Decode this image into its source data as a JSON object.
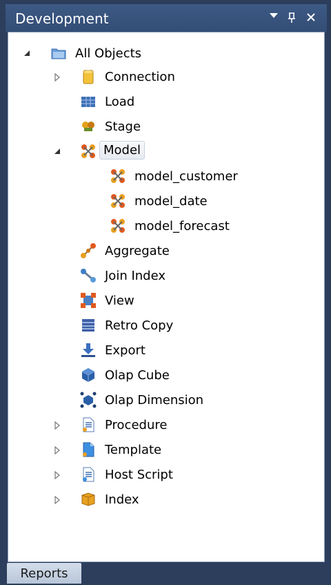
{
  "panel": {
    "title": "Development"
  },
  "tree": {
    "root_label": "All Objects",
    "nodes": {
      "connection": "Connection",
      "load": "Load",
      "stage": "Stage",
      "model": "Model",
      "model_customer": "model_customer",
      "model_date": "model_date",
      "model_forecast": "model_forecast",
      "aggregate": "Aggregate",
      "join_index": "Join Index",
      "view": "View",
      "retro_copy": "Retro Copy",
      "export": "Export",
      "olap_cube": "Olap Cube",
      "olap_dimension": "Olap Dimension",
      "procedure": "Procedure",
      "template": "Template",
      "host_script": "Host Script",
      "index": "Index"
    }
  },
  "bottom_tabs": {
    "reports": "Reports"
  }
}
